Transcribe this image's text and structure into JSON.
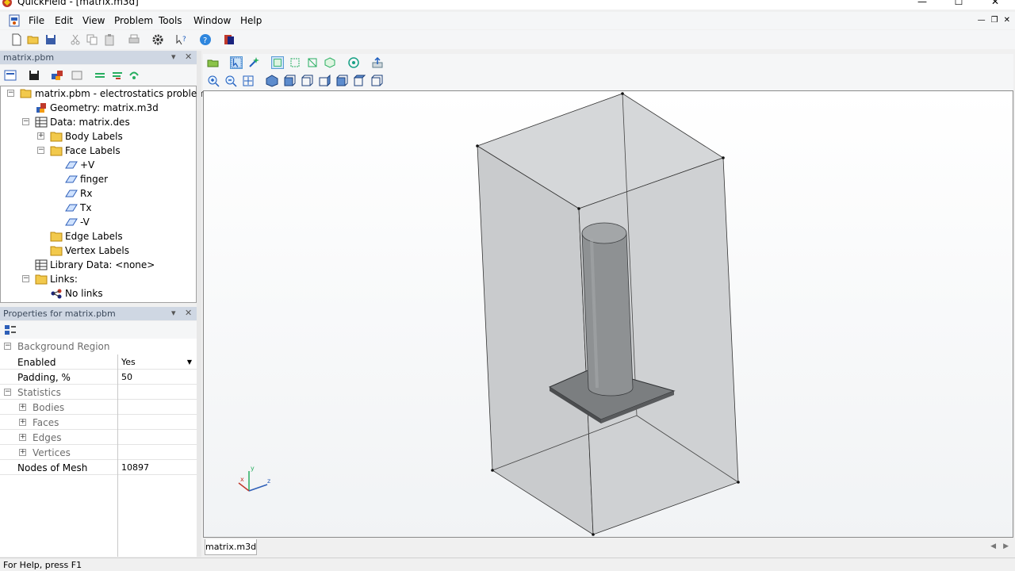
{
  "window": {
    "title": "QuickField - [matrix.m3d]",
    "minimize": "—",
    "maximize": "☐",
    "close": "✕"
  },
  "menu": {
    "items": [
      "File",
      "Edit",
      "View",
      "Problem",
      "Tools",
      "Window",
      "Help"
    ],
    "mdi_minimize": "—",
    "mdi_restore": "❐",
    "mdi_close": "✕"
  },
  "problem_panel": {
    "title": "matrix.pbm",
    "dropdown": "▾",
    "close": "✕"
  },
  "tree": {
    "root": "matrix.pbm - electrostatics problem",
    "geometry": "Geometry: matrix.m3d",
    "data": "Data: matrix.des",
    "body_labels": "Body Labels",
    "face_labels": "Face Labels",
    "faces": [
      "+V",
      "finger",
      "Rx",
      "Tx",
      "-V"
    ],
    "edge_labels": "Edge Labels",
    "vertex_labels": "Vertex Labels",
    "library": "Library Data: <none>",
    "links": "Links:",
    "no_links": "No links"
  },
  "properties_panel": {
    "title": "Properties for matrix.pbm",
    "dropdown": "▾",
    "close": "✕",
    "rows": {
      "background_region": "Background Region",
      "enabled": "Enabled",
      "enabled_value": "Yes",
      "padding": "Padding, %",
      "padding_value": "50",
      "statistics": "Statistics",
      "bodies": "Bodies",
      "faces": "Faces",
      "edges": "Edges",
      "vertices": "Vertices",
      "nodes_of_mesh": "Nodes of Mesh",
      "nodes_value": "10897"
    }
  },
  "viewport": {
    "axis_x": "x",
    "axis_y": "y",
    "axis_z": "z"
  },
  "doc_tabs": {
    "active": "matrix.m3d",
    "prev": "◀",
    "next": "▶"
  },
  "status": {
    "text": "For Help, press F1"
  }
}
